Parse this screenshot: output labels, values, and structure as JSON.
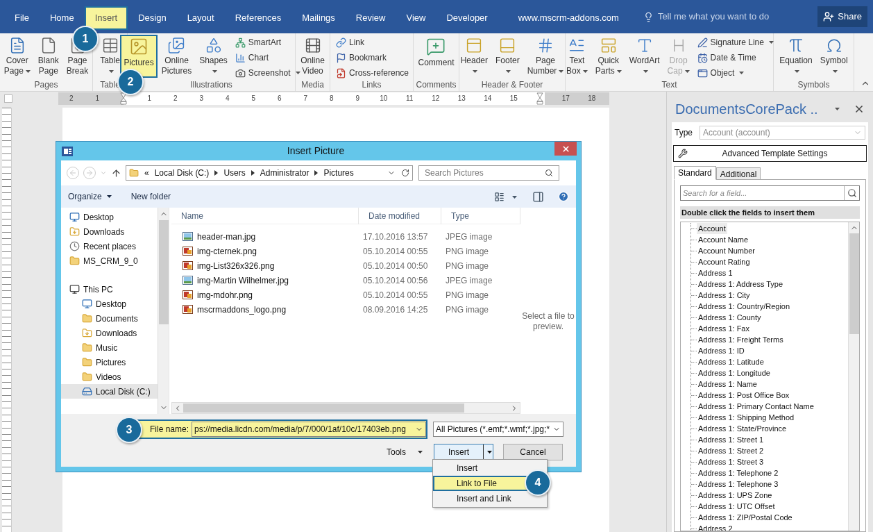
{
  "ribbon_tabs": [
    {
      "label": "File",
      "selected": false
    },
    {
      "label": "Home",
      "selected": false
    },
    {
      "label": "Insert",
      "selected": true
    },
    {
      "label": "Design",
      "selected": false
    },
    {
      "label": "Layout",
      "selected": false
    },
    {
      "label": "References",
      "selected": false
    },
    {
      "label": "Mailings",
      "selected": false
    },
    {
      "label": "Review",
      "selected": false
    },
    {
      "label": "View",
      "selected": false
    },
    {
      "label": "Developer",
      "selected": false
    },
    {
      "label": "www.mscrm-addons.com",
      "selected": false
    }
  ],
  "tell_me": {
    "placeholder": "Tell me what you want to do"
  },
  "share_button": "Share",
  "ribbon_groups": [
    {
      "label": "Pages",
      "commands": [
        {
          "kind": "large",
          "lines": [
            "Cover",
            "Page"
          ],
          "dropdown": true,
          "disabled": false,
          "highlighted": false
        },
        {
          "kind": "large",
          "lines": [
            "Blank",
            "Page"
          ],
          "dropdown": false,
          "disabled": false,
          "highlighted": false
        },
        {
          "kind": "large",
          "lines": [
            "Page",
            "Break"
          ],
          "dropdown": false,
          "disabled": false,
          "highlighted": false
        }
      ]
    },
    {
      "label": "Table",
      "commands": [
        {
          "kind": "large",
          "lines": [
            "Table"
          ],
          "dropdown": true,
          "disabled": false,
          "highlighted": false
        }
      ]
    },
    {
      "label": "Illustrations",
      "commands": [
        {
          "kind": "large",
          "lines": [
            "Pictures"
          ],
          "dropdown": false,
          "disabled": false,
          "highlighted": true
        },
        {
          "kind": "large",
          "lines": [
            "Online",
            "Pictures"
          ],
          "dropdown": false,
          "disabled": false,
          "highlighted": false
        },
        {
          "kind": "large",
          "lines": [
            "Shapes"
          ],
          "dropdown": true,
          "disabled": false,
          "highlighted": false
        },
        {
          "kind": "small",
          "lines": [
            "SmartArt"
          ],
          "dropdown": false,
          "disabled": false,
          "highlighted": false
        },
        {
          "kind": "small",
          "lines": [
            "Chart"
          ],
          "dropdown": false,
          "disabled": false,
          "highlighted": false
        },
        {
          "kind": "small",
          "lines": [
            "Screenshot"
          ],
          "dropdown": true,
          "disabled": false,
          "highlighted": false
        }
      ]
    },
    {
      "label": "Media",
      "commands": [
        {
          "kind": "large",
          "lines": [
            "Online",
            "Video"
          ],
          "dropdown": false,
          "disabled": false,
          "highlighted": false
        }
      ]
    },
    {
      "label": "Links",
      "commands": [
        {
          "kind": "small",
          "lines": [
            "Link"
          ],
          "dropdown": false,
          "disabled": false,
          "highlighted": false
        },
        {
          "kind": "small",
          "lines": [
            "Bookmark"
          ],
          "dropdown": false,
          "disabled": false,
          "highlighted": false
        },
        {
          "kind": "small",
          "lines": [
            "Cross-reference"
          ],
          "dropdown": false,
          "disabled": false,
          "highlighted": false
        }
      ]
    },
    {
      "label": "Comments",
      "commands": [
        {
          "kind": "large",
          "lines": [
            "Comment"
          ],
          "dropdown": false,
          "disabled": false,
          "highlighted": false
        }
      ]
    },
    {
      "label": "Header & Footer",
      "commands": [
        {
          "kind": "large",
          "lines": [
            "Header"
          ],
          "dropdown": true,
          "disabled": false,
          "highlighted": false
        },
        {
          "kind": "large",
          "lines": [
            "Footer"
          ],
          "dropdown": true,
          "disabled": false,
          "highlighted": false
        },
        {
          "kind": "large",
          "lines": [
            "Page",
            "Number"
          ],
          "dropdown": true,
          "disabled": false,
          "highlighted": false
        }
      ]
    },
    {
      "label": "Text",
      "commands": [
        {
          "kind": "large",
          "lines": [
            "Text",
            "Box"
          ],
          "dropdown": true,
          "disabled": false,
          "highlighted": false
        },
        {
          "kind": "large",
          "lines": [
            "Quick",
            "Parts"
          ],
          "dropdown": true,
          "disabled": false,
          "highlighted": false
        },
        {
          "kind": "large",
          "lines": [
            "WordArt"
          ],
          "dropdown": true,
          "disabled": false,
          "highlighted": false
        },
        {
          "kind": "large",
          "lines": [
            "Drop",
            "Cap"
          ],
          "dropdown": true,
          "disabled": true,
          "highlighted": false
        },
        {
          "kind": "small",
          "lines": [
            "Signature Line"
          ],
          "dropdown": true,
          "disabled": false,
          "highlighted": false
        },
        {
          "kind": "small",
          "lines": [
            "Date & Time"
          ],
          "dropdown": false,
          "disabled": false,
          "highlighted": false
        },
        {
          "kind": "small",
          "lines": [
            "Object"
          ],
          "dropdown": true,
          "disabled": false,
          "highlighted": false
        }
      ]
    },
    {
      "label": "Symbols",
      "commands": [
        {
          "kind": "large",
          "lines": [
            "Equation"
          ],
          "dropdown": true,
          "disabled": false,
          "highlighted": false
        },
        {
          "kind": "large",
          "lines": [
            "Symbol"
          ],
          "dropdown": true,
          "disabled": false,
          "highlighted": false
        }
      ]
    }
  ],
  "ruler_labels": [
    "2",
    "1",
    "1",
    "2",
    "3",
    "4",
    "5",
    "6",
    "7",
    "8",
    "9",
    "10",
    "11",
    "12",
    "13",
    "14",
    "15",
    "17",
    "18"
  ],
  "dialog": {
    "title": "Insert Picture",
    "path_overflow": "«",
    "path": [
      "Local Disk (C:)",
      "Users",
      "Administrator",
      "Pictures"
    ],
    "search": {
      "placeholder": "Search Pictures"
    },
    "organize": "Organize",
    "new_folder": "New folder",
    "nav_tree": [
      {
        "label": "Desktop",
        "kind": "desktop",
        "selected": false
      },
      {
        "label": "Downloads",
        "kind": "downloads",
        "selected": false
      },
      {
        "label": "Recent places",
        "kind": "recent",
        "selected": false
      },
      {
        "label": "MS_CRM_9_0",
        "kind": "folder",
        "selected": false
      },
      {
        "label": "This PC",
        "kind": "computer",
        "selected": false,
        "children": [
          {
            "label": "Desktop",
            "kind": "desktop",
            "selected": false
          },
          {
            "label": "Documents",
            "kind": "folder",
            "selected": false
          },
          {
            "label": "Downloads",
            "kind": "downloads",
            "selected": false
          },
          {
            "label": "Music",
            "kind": "folder",
            "selected": false
          },
          {
            "label": "Pictures",
            "kind": "folder",
            "selected": false
          },
          {
            "label": "Videos",
            "kind": "folder",
            "selected": false
          },
          {
            "label": "Local Disk (C:)",
            "kind": "drive",
            "selected": true
          }
        ]
      }
    ],
    "columns": [
      "Name",
      "Date modified",
      "Type"
    ],
    "files": [
      {
        "name": "header-man.jpg",
        "date": "17.10.2016 13:57",
        "type": "JPEG image",
        "kind": "jpeg"
      },
      {
        "name": "img-cternek.png",
        "date": "05.10.2014 00:55",
        "type": "PNG image",
        "kind": "png"
      },
      {
        "name": "img-List326x326.png",
        "date": "05.10.2014 00:50",
        "type": "PNG image",
        "kind": "png"
      },
      {
        "name": "img-Martin Wilhelmer.jpg",
        "date": "05.10.2014 00:56",
        "type": "JPEG image",
        "kind": "jpeg"
      },
      {
        "name": "img-mdohr.png",
        "date": "05.10.2014 00:55",
        "type": "PNG image",
        "kind": "png"
      },
      {
        "name": "mscrmaddons_logo.png",
        "date": "08.09.2016 14:25",
        "type": "PNG image",
        "kind": "png"
      }
    ],
    "preview_text": "Select a file to preview.",
    "file_name_label": "File name:",
    "file_name_value": "ps://media.licdn.com/media/p/7/000/1af/10c/17403eb.png",
    "filter": "All Pictures (*.emf;*.wmf;*.jpg;*",
    "tools": "Tools",
    "insert": "Insert",
    "cancel": "Cancel",
    "insert_menu": [
      {
        "label": "Insert",
        "selected": false
      },
      {
        "label": "Link to File",
        "selected": true
      },
      {
        "label": "Insert and Link",
        "selected": false
      }
    ]
  },
  "callouts": [
    "1",
    "2",
    "3",
    "4"
  ],
  "side_pane": {
    "title": "DocumentsCorePack ..",
    "type_label": "Type",
    "type_value": "Account (account)",
    "advanced_button": "Advanced Template Settings",
    "tabs": [
      {
        "label": "Standard",
        "selected": true
      },
      {
        "label": "Additional",
        "selected": false
      }
    ],
    "search": {
      "placeholder": "Search for a field..."
    },
    "hint": "Double click the fields to insert them",
    "fields": [
      {
        "label": "Account",
        "selected": true
      },
      {
        "label": "Account Name",
        "selected": false
      },
      {
        "label": "Account Number",
        "selected": false
      },
      {
        "label": "Account Rating",
        "selected": false
      },
      {
        "label": "Address 1",
        "selected": false
      },
      {
        "label": "Address 1: Address Type",
        "selected": false
      },
      {
        "label": "Address 1: City",
        "selected": false
      },
      {
        "label": "Address 1: Country/Region",
        "selected": false
      },
      {
        "label": "Address 1: County",
        "selected": false
      },
      {
        "label": "Address 1: Fax",
        "selected": false
      },
      {
        "label": "Address 1: Freight Terms",
        "selected": false
      },
      {
        "label": "Address 1: ID",
        "selected": false
      },
      {
        "label": "Address 1: Latitude",
        "selected": false
      },
      {
        "label": "Address 1: Longitude",
        "selected": false
      },
      {
        "label": "Address 1: Name",
        "selected": false
      },
      {
        "label": "Address 1: Post Office Box",
        "selected": false
      },
      {
        "label": "Address 1: Primary Contact Name",
        "selected": false
      },
      {
        "label": "Address 1: Shipping Method",
        "selected": false
      },
      {
        "label": "Address 1: State/Province",
        "selected": false
      },
      {
        "label": "Address 1: Street 1",
        "selected": false
      },
      {
        "label": "Address 1: Street 2",
        "selected": false
      },
      {
        "label": "Address 1: Street 3",
        "selected": false
      },
      {
        "label": "Address 1: Telephone 2",
        "selected": false
      },
      {
        "label": "Address 1: Telephone 3",
        "selected": false
      },
      {
        "label": "Address 1: UPS Zone",
        "selected": false
      },
      {
        "label": "Address 1: UTC Offset",
        "selected": false
      },
      {
        "label": "Address 1: ZIP/Postal Code",
        "selected": false
      },
      {
        "label": "Address 2",
        "selected": false
      }
    ]
  }
}
